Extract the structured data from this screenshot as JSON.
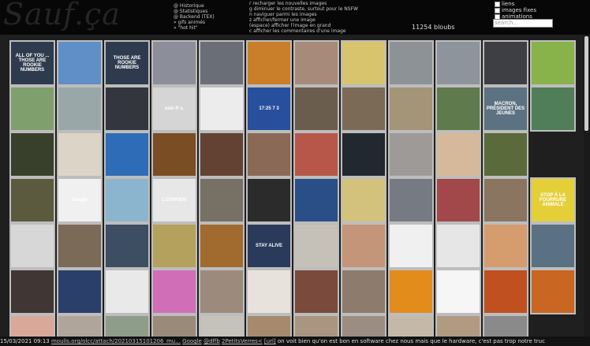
{
  "header": {
    "logo": "Sauf.ça",
    "nav": [
      "@ Historique",
      "@ Statistiques",
      "@ Backend (TEX)",
      "",
      "» gifs animés",
      "» \"hot hit\""
    ],
    "keys": [
      "r recharger les nouvelles images",
      "g diminuer le contraste, surtout pour le NSFW",
      "n naviguer parmi les images",
      "z afficher/fermer une image",
      "(espace) afficher l'image en grand",
      "c afficher les commentaires d'une image"
    ],
    "count": "11254 bloubs",
    "options": [
      {
        "label": "liens",
        "checked": true
      },
      {
        "label": "images fixes",
        "checked": true
      },
      {
        "label": "animations",
        "checked": true
      }
    ],
    "search_placeholder": "search..."
  },
  "grid": {
    "rows": [
      [
        {
          "c": "#2e3b4f",
          "t": "ALL OF YOU ... THOSE ARE ROOKIE NUMBERS"
        },
        {
          "c": "#5f8fc6",
          "t": ""
        },
        {
          "c": "#2e3b4f",
          "t": "THOSE ARE ROOKIE NUMBERS"
        },
        {
          "c": "#8c8f99",
          "t": ""
        },
        {
          "c": "#6a6f77",
          "t": ""
        },
        {
          "c": "#c97e2a",
          "t": ""
        },
        {
          "c": "#a78a7a",
          "t": ""
        },
        {
          "c": "#d8c46d",
          "t": ""
        },
        {
          "c": "#8d9296",
          "t": ""
        },
        {
          "c": "#8d949c",
          "t": ""
        },
        {
          "c": "#3d3f44",
          "t": ""
        },
        {
          "c": "#88b24a",
          "t": ""
        }
      ],
      [
        {
          "c": "#7fa06d",
          "t": ""
        },
        {
          "c": "#9aa7a8",
          "t": ""
        },
        {
          "c": "#33373d",
          "t": ""
        },
        {
          "c": "#d5d5d5",
          "t": "ssin R s."
        },
        {
          "c": "#ececec",
          "t": ""
        },
        {
          "c": "#284f9b",
          "t": "17:25 7 3"
        },
        {
          "c": "#6b5d4d",
          "t": ""
        },
        {
          "c": "#7b6a56",
          "t": ""
        },
        {
          "c": "#a49478",
          "t": ""
        },
        {
          "c": "#5f7a4c",
          "t": ""
        },
        {
          "c": "#5c7182",
          "t": "MACRON, PRÉSIDENT DES JEUNES"
        },
        {
          "c": "#4f7e59",
          "t": ""
        }
      ],
      [
        {
          "c": "#38402c",
          "t": ""
        },
        {
          "c": "#dcd5c7",
          "t": ""
        },
        {
          "c": "#2f6cb7",
          "t": ""
        },
        {
          "c": "#7a4d24",
          "t": ""
        },
        {
          "c": "#634234",
          "t": ""
        },
        {
          "c": "#8a6a56",
          "t": ""
        },
        {
          "c": "#b6574a",
          "t": ""
        },
        {
          "c": "#222830",
          "t": ""
        },
        {
          "c": "#9e9a98",
          "t": ""
        },
        {
          "c": "#d6b89a",
          "t": ""
        },
        {
          "c": "#5a6a3a",
          "t": ""
        }
      ],
      [
        {
          "c": "#5b5a3e",
          "t": ""
        },
        {
          "c": "#f0f0f0",
          "t": "Google"
        },
        {
          "c": "#8bb5cf",
          "t": ""
        },
        {
          "c": "#e7e7e7",
          "t": "LOTHRIEN"
        },
        {
          "c": "#777165",
          "t": ""
        },
        {
          "c": "#2b2b2b",
          "t": ""
        },
        {
          "c": "#2a4f86",
          "t": ""
        },
        {
          "c": "#d3c27c",
          "t": ""
        },
        {
          "c": "#757a83",
          "t": ""
        },
        {
          "c": "#a2484a",
          "t": ""
        },
        {
          "c": "#8a7560",
          "t": ""
        },
        {
          "c": "#e5cf39",
          "t": "STOP À LA FOURRURE ANIMALE"
        }
      ],
      [
        {
          "c": "#d7d7d7",
          "t": ""
        },
        {
          "c": "#7b6a58",
          "t": ""
        },
        {
          "c": "#3d4d62",
          "t": ""
        },
        {
          "c": "#b4a15e",
          "t": ""
        },
        {
          "c": "#a16a2f",
          "t": ""
        },
        {
          "c": "#2a3a5a",
          "t": "STAY ALIVE"
        },
        {
          "c": "#c6c1b8",
          "t": ""
        },
        {
          "c": "#c49579",
          "t": ""
        },
        {
          "c": "#f0f0f0",
          "t": ""
        },
        {
          "c": "#e6e6e6",
          "t": ""
        },
        {
          "c": "#d59c6e",
          "t": ""
        },
        {
          "c": "#5a7083",
          "t": ""
        }
      ],
      [
        {
          "c": "#403633",
          "t": ""
        },
        {
          "c": "#2b3f6b",
          "t": ""
        },
        {
          "c": "#e9e9e9",
          "t": ""
        },
        {
          "c": "#d06fb8",
          "t": ""
        },
        {
          "c": "#9c8b7d",
          "t": ""
        },
        {
          "c": "#e7e3dc",
          "t": ""
        },
        {
          "c": "#7a4a3c",
          "t": ""
        },
        {
          "c": "#8d7b6d",
          "t": ""
        },
        {
          "c": "#e28c1c",
          "t": ""
        },
        {
          "c": "#f6f6f6",
          "t": ""
        },
        {
          "c": "#c0501f",
          "t": ""
        },
        {
          "c": "#c86622",
          "t": ""
        }
      ],
      [
        {
          "c": "#d9a898",
          "t": ""
        },
        {
          "c": "#b0a59b",
          "t": ""
        },
        {
          "c": "#8e9c8a",
          "t": ""
        },
        {
          "c": "#9a8a7a",
          "t": ""
        },
        {
          "c": "#c5c1bb",
          "t": ""
        },
        {
          "c": "#a58a6e",
          "t": ""
        },
        {
          "c": "#aa9680",
          "t": ""
        },
        {
          "c": "#9c8d82",
          "t": ""
        },
        {
          "c": "#c4b8a8",
          "t": ""
        },
        {
          "c": "#b09a82",
          "t": ""
        },
        {
          "c": "#8a8a8a",
          "t": ""
        }
      ]
    ]
  },
  "footer": {
    "date": "15/03/2021 09:13",
    "link": "moulis.org/olcc/attach/20210315101206_mu...",
    "google": "Google",
    "dfb": "@dffb",
    "petits": "2PetitsVerres<",
    "url": "[url]",
    "text": "on voit bien qu'on est bon en software chez nous mais que le hardware, c'est pas trop notre truc"
  }
}
